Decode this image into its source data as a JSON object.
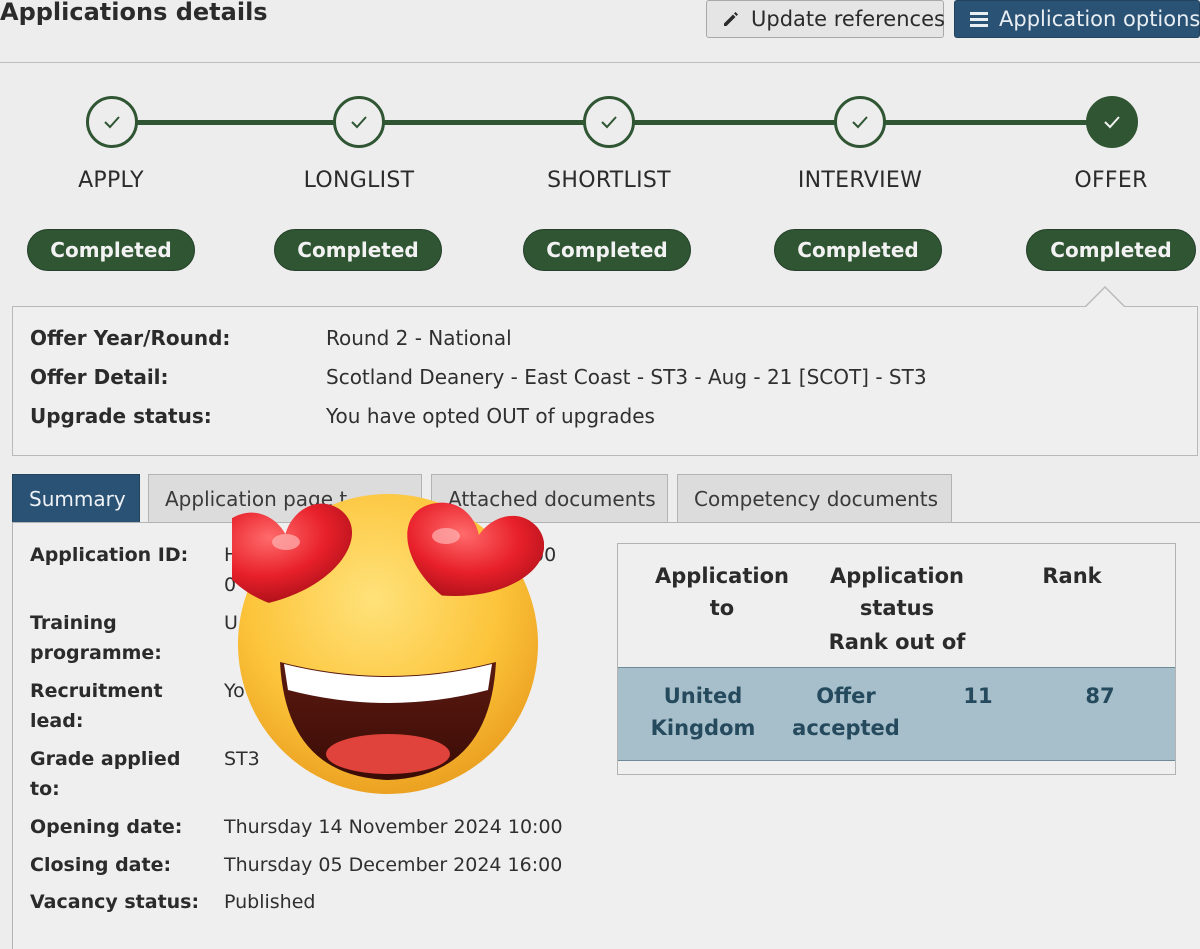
{
  "header": {
    "title": "Applications details",
    "update_button_label": "Update references",
    "options_button_label": "Application options"
  },
  "steps": [
    {
      "label": "APPLY",
      "status": "Completed"
    },
    {
      "label": "LONGLIST",
      "status": "Completed"
    },
    {
      "label": "SHORTLIST",
      "status": "Completed"
    },
    {
      "label": "INTERVIEW",
      "status": "Completed"
    },
    {
      "label": "OFFER",
      "status": "Completed"
    }
  ],
  "offer": {
    "year_round_label": "Offer Year/Round:",
    "year_round_value": "Round 2 - National",
    "detail_label": "Offer Detail:",
    "detail_value": "Scotland Deanery - East Coast - ST3 - Aug - 21 [SCOT] - ST3",
    "upgrade_label": "Upgrade status:",
    "upgrade_value": "You have opted OUT of upgrades"
  },
  "tabs": [
    {
      "label": "Summary"
    },
    {
      "label": "Application page t"
    },
    {
      "label": "Attached documents"
    },
    {
      "label": "Competency documents"
    }
  ],
  "summary": {
    "application_id_label": "Application ID:",
    "application_id_value": "H",
    "application_id_value_2": "0",
    "application_id_tail": "00",
    "training_programme_label": "Training programme:",
    "training_programme_value": "U",
    "recruitment_lead_label": "Recruitment lead:",
    "recruitment_lead_value": "Yo",
    "grade_label": "Grade applied to:",
    "grade_value": "ST3",
    "opening_date_label": "Opening date:",
    "opening_date_value": "Thursday 14 November 2024 10:00",
    "closing_date_label": "Closing date:",
    "closing_date_value": "Thursday 05 December 2024 16:00",
    "vacancy_status_label": "Vacancy status:",
    "vacancy_status_value": "Published"
  },
  "rank_table": {
    "col_application_to": "Application to",
    "col_application_status": "Application status",
    "col_rank_out_of": "Rank out of",
    "col_rank": "Rank",
    "row": {
      "application_to": "United Kingdom",
      "status": "Offer accepted",
      "rank_out_of": "11",
      "rank": "87"
    }
  },
  "overlay": {
    "icon": "heart-eyes-emoji-icon"
  },
  "colors": {
    "step_green": "#2f5533",
    "tab_active_blue": "#2a5274",
    "row_highlight": "#a7bfca"
  }
}
